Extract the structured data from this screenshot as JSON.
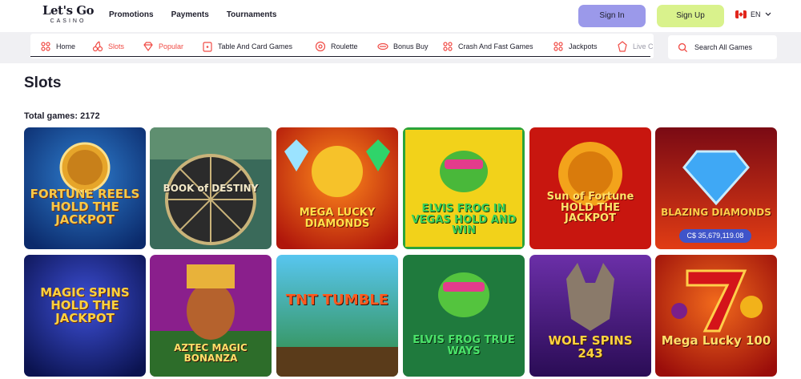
{
  "header": {
    "logo_line1": "Let's Go",
    "logo_line2": "CASINO",
    "nav": [
      "Promotions",
      "Payments",
      "Tournaments"
    ],
    "signin_label": "Sign In",
    "signup_label": "Sign Up",
    "language": "EN"
  },
  "categories": [
    {
      "label": "Home",
      "icon": "home-icon",
      "active": false
    },
    {
      "label": "Slots",
      "icon": "cherries-icon",
      "active": true
    },
    {
      "label": "Popular",
      "icon": "diamond-icon",
      "active": true
    },
    {
      "label": "Table And Card Games",
      "icon": "cards-icon",
      "active": false
    },
    {
      "label": "Roulette",
      "icon": "roulette-icon",
      "active": false
    },
    {
      "label": "Bonus Buy",
      "icon": "bonus-icon",
      "active": false
    },
    {
      "label": "Crash And Fast Games",
      "icon": "crash-icon",
      "active": false
    },
    {
      "label": "Jackpots",
      "icon": "jackpot-icon",
      "active": false
    },
    {
      "label": "Live C",
      "icon": "live-icon",
      "active": false
    }
  ],
  "search": {
    "placeholder": "Search All Games"
  },
  "page": {
    "title": "Slots",
    "total_label": "Total games: 2172"
  },
  "colors": {
    "accent": "#f04b45",
    "signin": "#9b99ea",
    "signup": "#d9f28c",
    "jackpot_pill": "#3f54c9"
  },
  "games": [
    {
      "title": "FORTUNE REELS HOLD THE JACKPOT"
    },
    {
      "title": "BOOK of DESTINY"
    },
    {
      "title": "MEGA LUCKY DIAMONDS"
    },
    {
      "title": "ELVIS FROG IN VEGAS HOLD AND WIN"
    },
    {
      "title": "Sun of Fortune HOLD THE JACKPOT"
    },
    {
      "title": "BLAZING DIAMONDS",
      "jackpot": "C$ 35,679,119.08"
    },
    {
      "title": "MAGIC SPINS HOLD THE JACKPOT"
    },
    {
      "title": "AZTEC MAGIC BONANZA"
    },
    {
      "title": "TNT TUMBLE"
    },
    {
      "title": "ELVIS FROG TRUE WAYS"
    },
    {
      "title": "WOLF SPINS 243"
    },
    {
      "title": "Mega Lucky 100"
    }
  ]
}
